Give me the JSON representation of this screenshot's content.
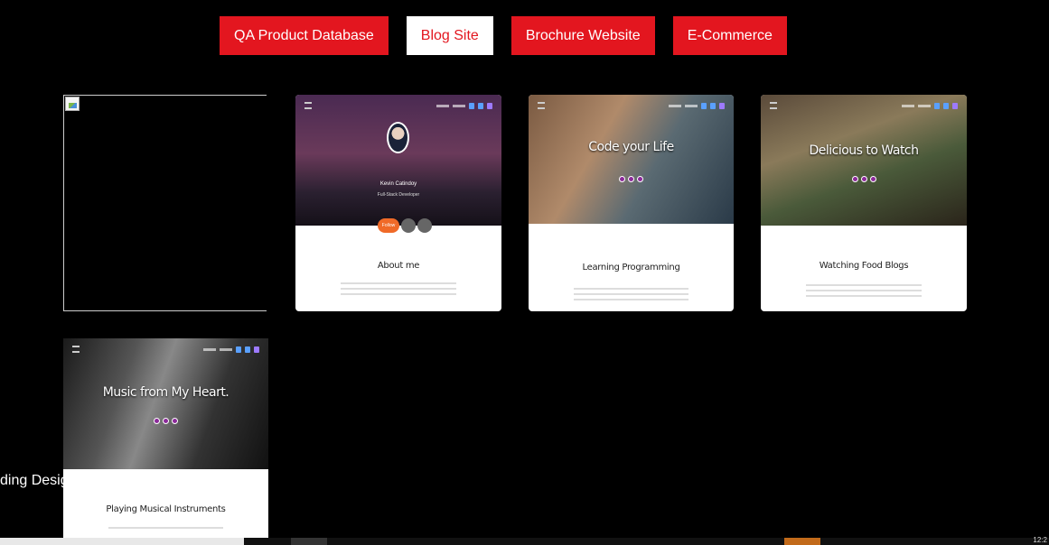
{
  "filters": [
    {
      "label": "QA Product Database",
      "active": false
    },
    {
      "label": "Blog Site",
      "active": true
    },
    {
      "label": "Brochure Website",
      "active": false
    },
    {
      "label": "E-Commerce",
      "active": false
    }
  ],
  "cards": {
    "portfolio": {
      "name": "Kevin Catindoy",
      "role": "Full-Stack Developer",
      "button": "Follow",
      "section": "About me"
    },
    "coding": {
      "hero": "Code your Life",
      "section": "Learning Programming"
    },
    "food": {
      "hero": "Delicious to Watch",
      "section": "Watching Food Blogs"
    },
    "music": {
      "hero": "Music from My Heart.",
      "section": "Playing Musical Instruments"
    }
  },
  "side_text": "ding Desig",
  "taskbar": {
    "clock": "12:2"
  },
  "colors": {
    "accent": "#e3161f",
    "background": "#000000"
  }
}
